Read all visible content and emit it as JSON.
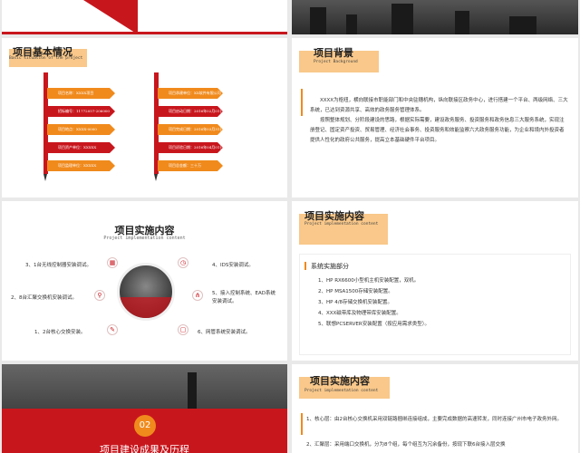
{
  "slide_basic": {
    "title": "项目基本情况",
    "subtitle": "Basic situation of the project",
    "left_items": [
      "项目名称：XXXX项目",
      "招标编号：11772057-206000",
      "项目地点：XXXX-0000",
      "项目资产单位：XXXXX",
      "项目监理单位：XXXXX"
    ],
    "right_items": [
      "项目承建单位：XX软件有限公司",
      "项目启动日期：2016年02月01日",
      "项目完成日期：2016年03月31日",
      "项目初验日期：2016年04月01日",
      "项目总金额：三十万"
    ]
  },
  "slide_background": {
    "title": "项目背景",
    "subtitle": "Project Background",
    "paragraph1": "XXXX为枢纽，横向联接市职能部门和中央驻穗机构，纵向联接区政务中心，进行搭建一个平台、两级网络、三大系统，已达到资源共享、高效的政务服务管理体系。",
    "paragraph2": "按照整体规划、分阶段建设的思路，根据实际需要，建设政务服务、投资服务和政务信息三大服务系统，实现注册登记、固定资产投资、贸易管理、经济社会事务、投资服务和效能监察六大政务服务功能，为企业和境内外投资者提供人性化的政府公共服务，提高立本基础硬件平台项目。"
  },
  "slide_impl_a": {
    "title": "项目实施内容",
    "subtitle": "Project implementation content",
    "items": [
      "3、1台无线控制器安装调试。",
      "4、IDS安装调试。",
      "2、8台汇聚交换机安装调试。",
      "5、接入控制系统、EAD系统安装调试。",
      "1、2台核心交换安装。",
      "6、网管系统安装调试。"
    ]
  },
  "slide_impl_b": {
    "title": "项目实施内容",
    "subtitle": "Project implementation content",
    "list_title": "系统实施部分",
    "items": [
      "1、HP RX6600小型机主机安装配置，双机。",
      "2、HP MSA1500存储安装配置。",
      "3、HP 4/8存储交换机安装配置。",
      "4、XXX磁带库及物理带库安装配置。",
      "5、联想PCSERVER安装配置（按应用需求类型）。"
    ]
  },
  "slide_section": {
    "number": "02",
    "title": "项目建设成果及历程"
  },
  "slide_impl_c": {
    "title": "项目实施内容",
    "subtitle": "Project implementation content",
    "items": [
      "1、核心层：由2台核心交换机采用双链路捆绑连接组成，主要完成数据的高速转发，同时连接广州市电子政务外网。",
      "2、汇聚层：采用端口交换机，分为8个组，每个组互为冗余备份，按现下联6台接入层交换"
    ]
  },
  "colors": {
    "red": "#c8161d",
    "orange": "#f08a1c",
    "tag": "#f9c88a"
  }
}
